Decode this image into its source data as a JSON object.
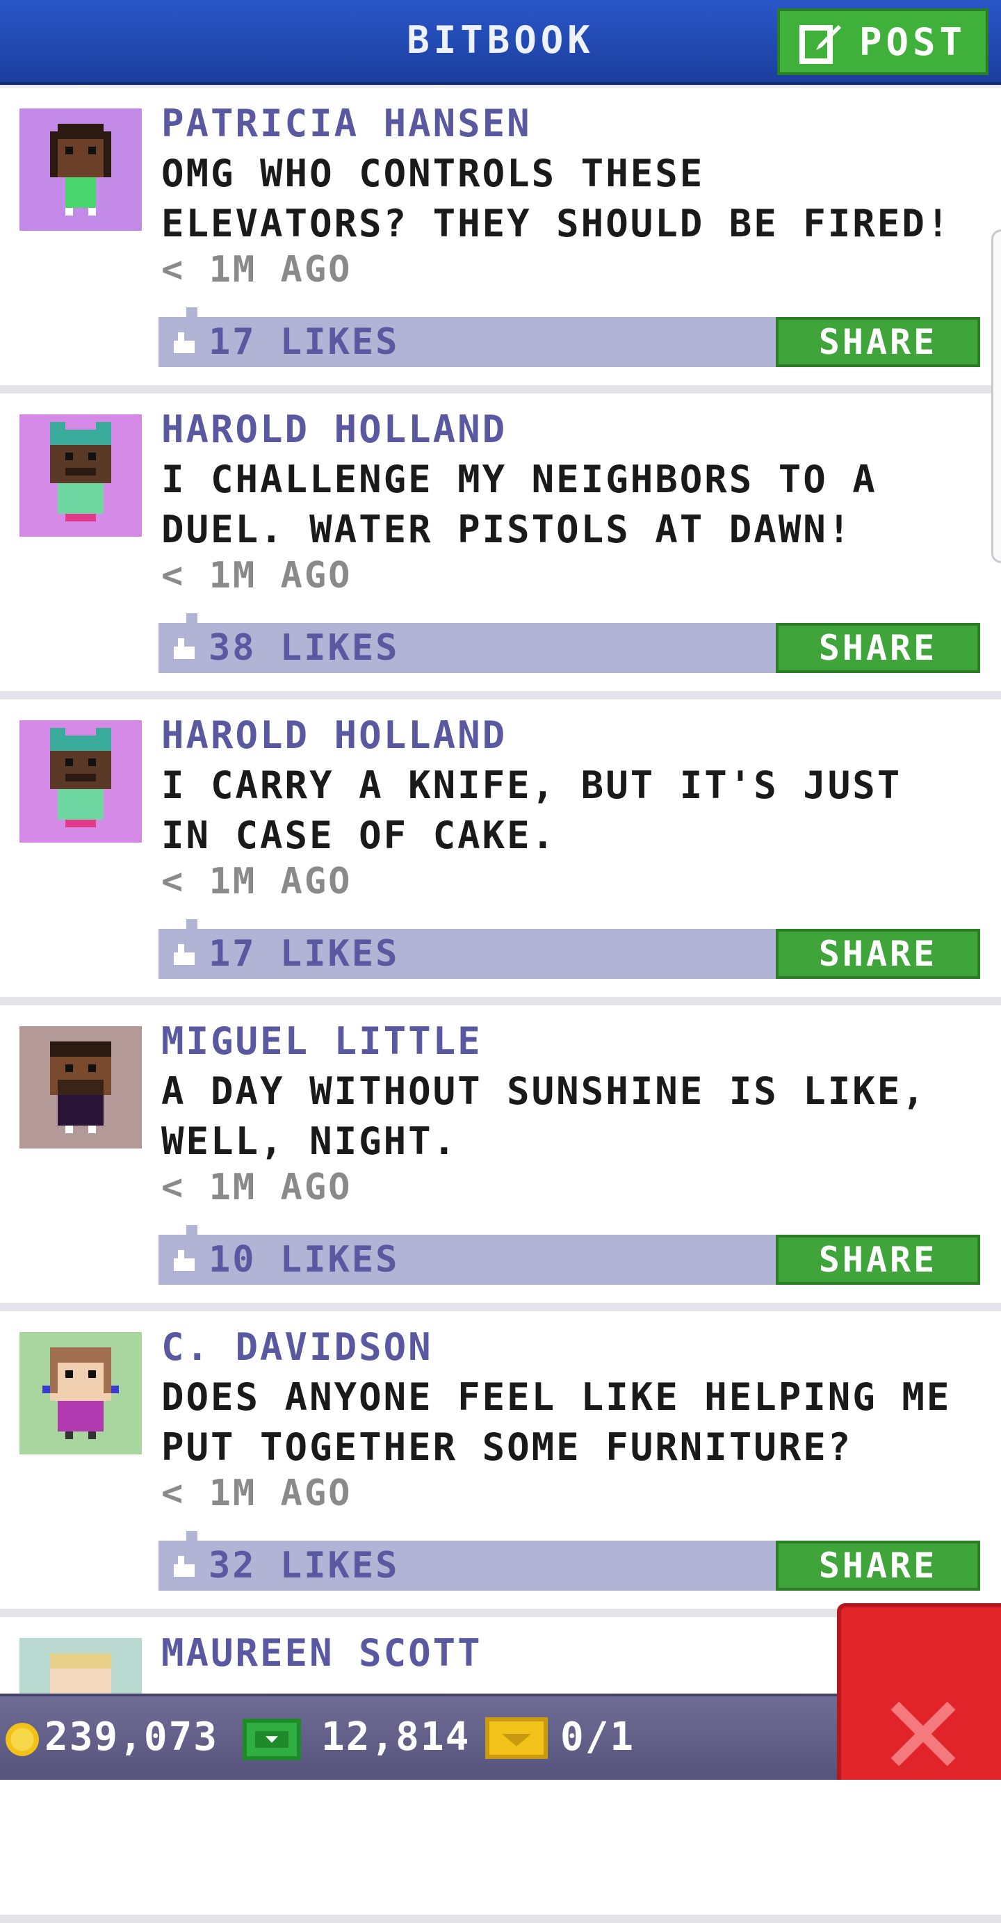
{
  "header": {
    "title": "BITBOOK",
    "post_label": "POST",
    "post_icon": "edit-icon"
  },
  "posts": [
    {
      "author": "PATRICIA HANSEN",
      "message": "OMG WHO CONTROLS THESE ELEVATORS? THEY SHOULD BE FIRED!",
      "time": "< 1M AGO",
      "likes": "17 LIKES",
      "share_label": "SHARE",
      "avatar_bg": "#c48ae8"
    },
    {
      "author": "HAROLD HOLLAND",
      "message": "I CHALLENGE MY NEIGHBORS TO A DUEL. WATER PISTOLS AT DAWN!",
      "time": "< 1M AGO",
      "likes": "38 LIKES",
      "share_label": "SHARE",
      "avatar_bg": "#d58ae8"
    },
    {
      "author": "HAROLD HOLLAND",
      "message": "I CARRY A KNIFE, BUT IT'S JUST IN CASE OF CAKE.",
      "time": "< 1M AGO",
      "likes": "17 LIKES",
      "share_label": "SHARE",
      "avatar_bg": "#d58ae8"
    },
    {
      "author": "MIGUEL LITTLE",
      "message": "A DAY WITHOUT SUNSHINE IS LIKE, WELL, NIGHT.",
      "time": "< 1M AGO",
      "likes": "10 LIKES",
      "share_label": "SHARE",
      "avatar_bg": "#b39a98"
    },
    {
      "author": "C. DAVIDSON",
      "message": "DOES ANYONE FEEL LIKE HELPING ME PUT TOGETHER SOME FURNITURE?",
      "time": "< 1M AGO",
      "likes": "32 LIKES",
      "share_label": "SHARE",
      "avatar_bg": "#a9d69f"
    },
    {
      "author": "MAUREEN SCOTT",
      "message": "",
      "time": "",
      "likes": "",
      "share_label": "",
      "avatar_bg": "#b8d8d0"
    }
  ],
  "status": {
    "coins": "239,073",
    "bux": "12,814",
    "tickets": "0/1",
    "coin_icon": "coin-icon",
    "bux_icon": "bux-icon",
    "ticket_icon": "golden-ticket-icon"
  },
  "colors": {
    "header": "#2249b5",
    "post_button": "#3fb03a",
    "share_button": "#3fa43a",
    "like_bar": "#b2b4d6",
    "author_text": "#5a58a0",
    "close_button": "#e1252b"
  }
}
